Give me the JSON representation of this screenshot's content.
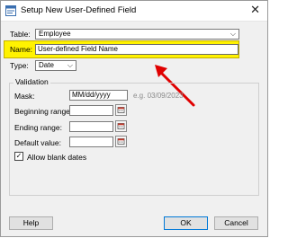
{
  "window": {
    "title": "Setup New User-Defined Field",
    "close_glyph": "✕"
  },
  "form": {
    "table_label": "Table:",
    "table_value": "Employee",
    "name_label": "Name:",
    "name_value": "User-defined Field Name",
    "type_label": "Type:",
    "type_value": "Date"
  },
  "validation": {
    "group_label": "Validation",
    "mask_label": "Mask:",
    "mask_value": "MM/dd/yyyy",
    "mask_example": "e.g. 03/09/2023",
    "beginning_label": "Beginning range:",
    "beginning_value": "",
    "ending_label": "Ending range:",
    "ending_value": "",
    "default_label": "Default value:",
    "default_value": "",
    "allow_blank_label": "Allow blank dates",
    "allow_blank_checked": true
  },
  "buttons": {
    "help": "Help",
    "ok": "OK",
    "cancel": "Cancel"
  },
  "annotation": {
    "highlight_color": "#fff200",
    "arrow_color": "#e00000"
  },
  "icons": {
    "title": "form-icon",
    "date_picker": "calendar-icon",
    "dropdown": "chevron-down-icon"
  }
}
